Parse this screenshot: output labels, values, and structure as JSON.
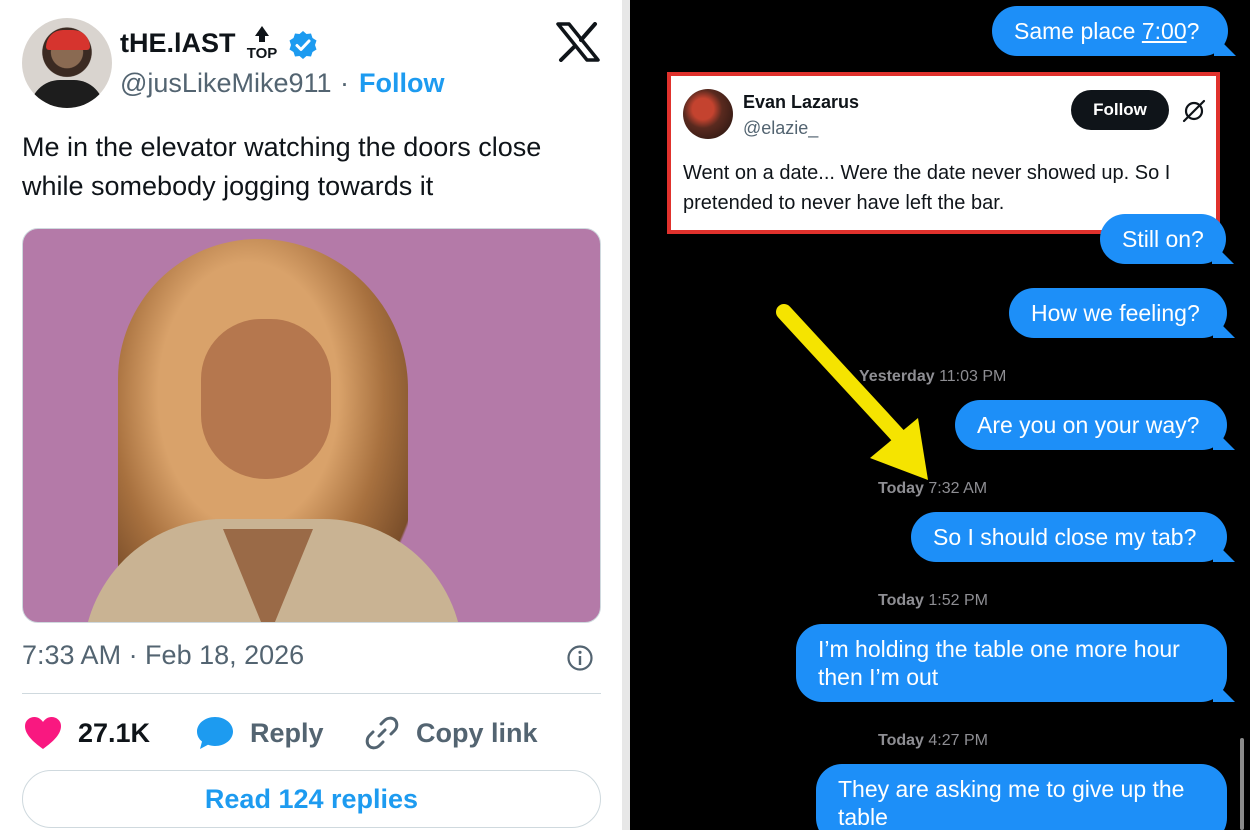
{
  "tweet": {
    "display_name": "tHE.lAST",
    "badge_text": "TOP",
    "handle": "@jusLikeMike911",
    "separator": "·",
    "follow_label": "Follow",
    "text": "Me in the elevator watching the doors close while somebody jogging towards it",
    "timestamp": "7:33 AM · Feb 18, 2026",
    "actions": {
      "like_count": "27.1K",
      "reply_label": "Reply",
      "copy_label": "Copy link"
    },
    "read_replies_label": "Read 124 replies",
    "icons": [
      "verified-badge-icon",
      "x-logo-icon",
      "info-icon",
      "heart-icon",
      "reply-bubble-icon",
      "link-icon"
    ],
    "colors": {
      "accent": "#1d9bf0",
      "like": "#f91880",
      "text": "#0f1419",
      "muted": "#536471"
    }
  },
  "messages": {
    "bubbles": [
      {
        "id": "b1",
        "text_before": "Same place ",
        "text_link": "7:00",
        "text_after": "?"
      },
      {
        "id": "b2",
        "text": "Still on?"
      },
      {
        "id": "b3",
        "text": "How we feeling?"
      },
      {
        "id": "b4",
        "text": "Are you on your way?"
      },
      {
        "id": "b5",
        "text": "So I should close my tab?"
      },
      {
        "id": "b6",
        "text": "I’m holding the table one more hour then I’m out"
      },
      {
        "id": "b7",
        "text": "They are asking me to give up the table"
      }
    ],
    "timestamps": [
      {
        "day": "Yesterday",
        "time": "11:03 PM"
      },
      {
        "day": "Today",
        "time": "7:32 AM"
      },
      {
        "day": "Today",
        "time": "1:52 PM"
      },
      {
        "day": "Today",
        "time": "4:27 PM"
      }
    ],
    "embed": {
      "name": "Evan Lazarus",
      "handle": "@elazie_",
      "follow_label": "Follow",
      "text": "Went on a date... Were the date never showed up. So I pretended to never have left the bar."
    },
    "colors": {
      "bubble": "#1d8ff8",
      "background": "#000000",
      "highlight_border": "#e0312c",
      "arrow": "#f5e400"
    }
  }
}
